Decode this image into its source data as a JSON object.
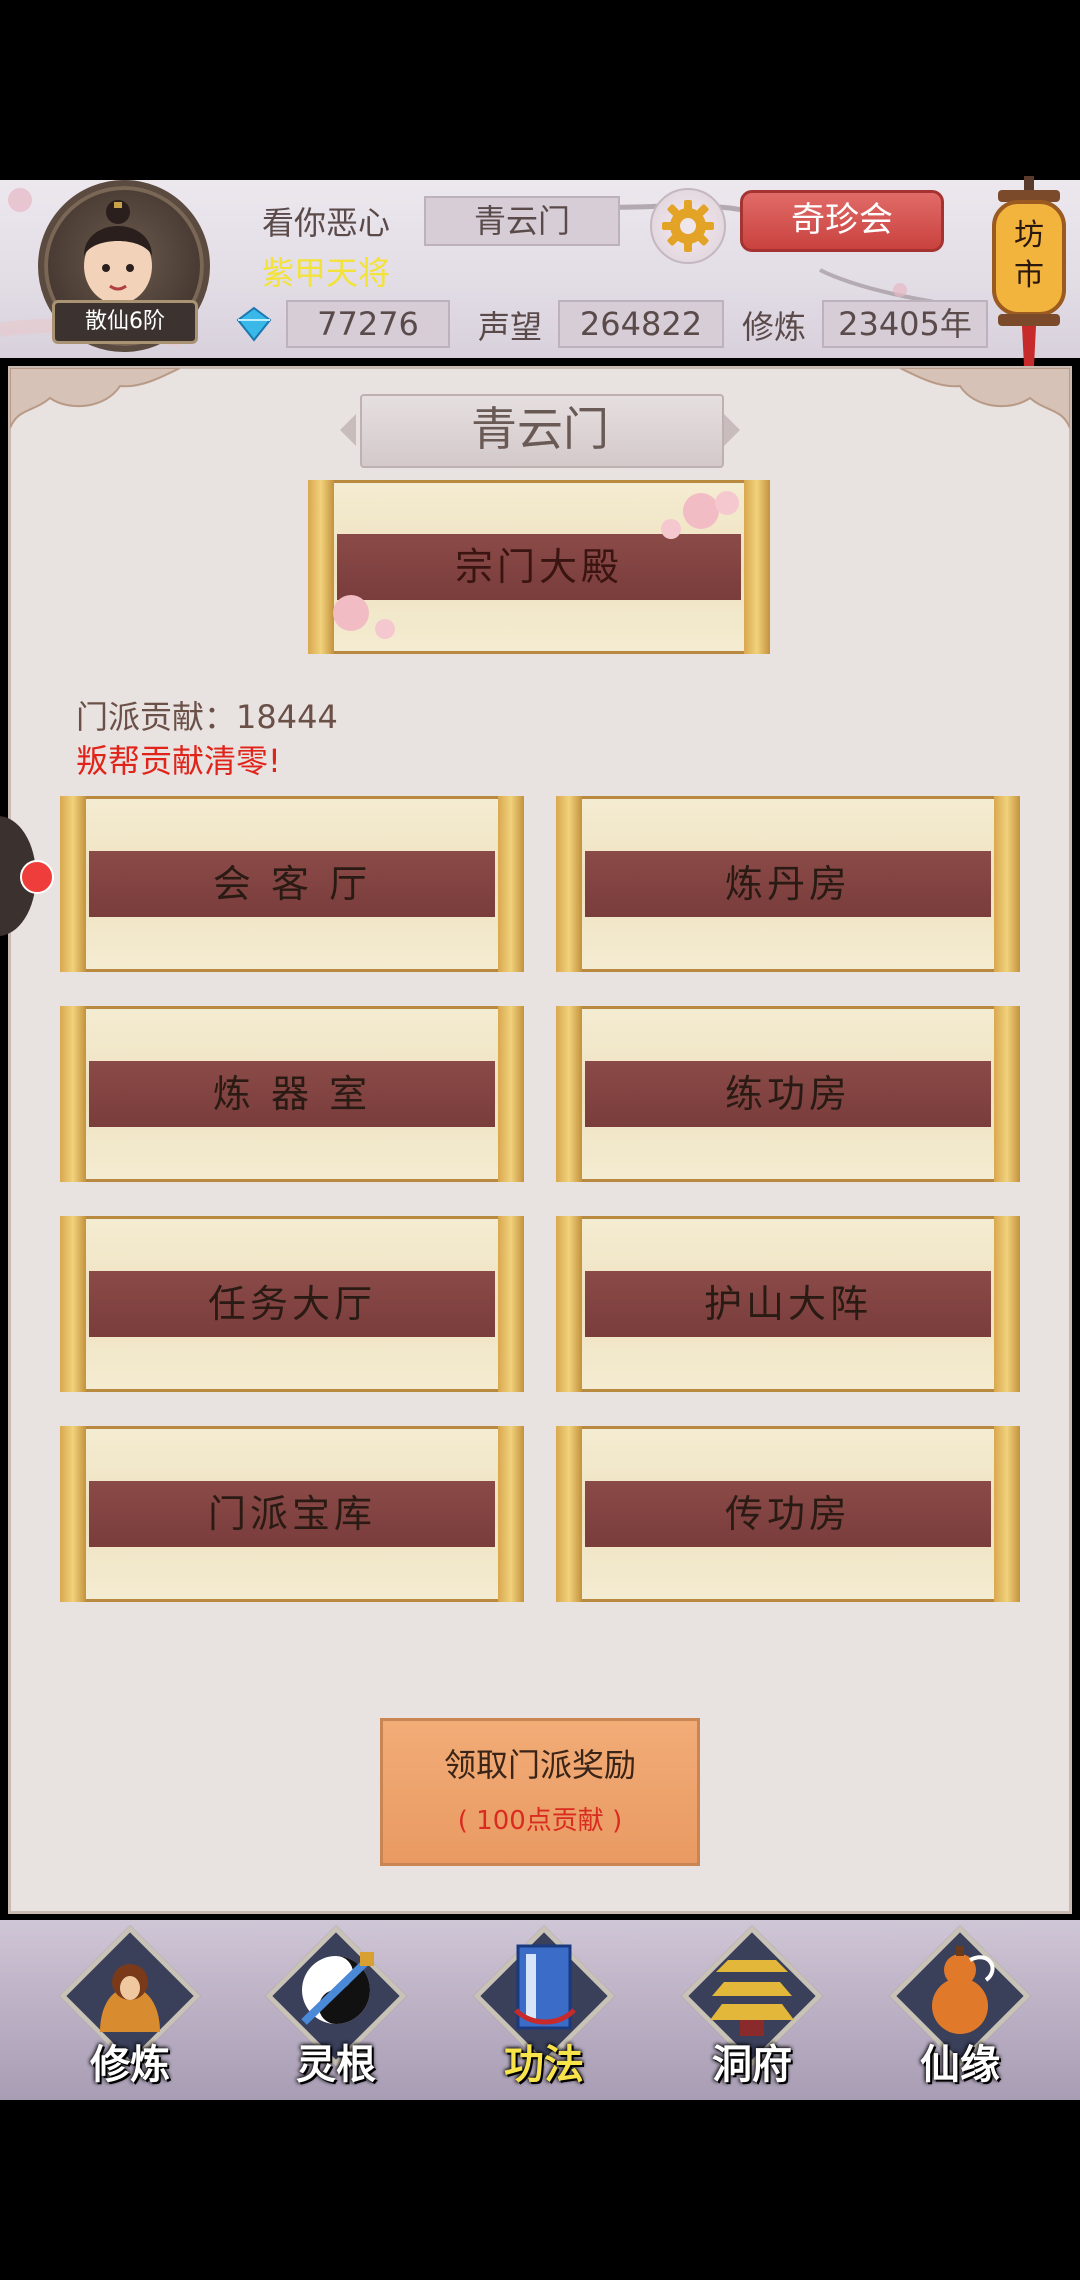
{
  "header": {
    "rank": "散仙6阶",
    "player_name": "看你恶心",
    "title": "紫甲天将",
    "sect_name": "青云门",
    "treasure_button": "奇珍会",
    "lantern_text": [
      "坊",
      "市"
    ],
    "gems": "77276",
    "reputation_label": "声望",
    "reputation": "264822",
    "cultivation_label": "修炼",
    "cultivation": "23405年"
  },
  "main": {
    "sect_title": "青云门",
    "hall_button": "宗门大殿",
    "contribution": "门派贡献：18444",
    "warning": "叛帮贡献清零!",
    "buildings": [
      "会 客 厅",
      "炼丹房",
      "炼 器 室",
      "练功房",
      "任务大厅",
      "护山大阵",
      "门派宝库",
      "传功房"
    ],
    "reward_button": {
      "line1": "领取门派奖励",
      "line2": "( 100点贡献 )"
    }
  },
  "bottom_nav": [
    {
      "label": "修炼",
      "icon": "monk-icon",
      "color": "#d98b2f"
    },
    {
      "label": "灵根",
      "icon": "yin-yang-sword-icon",
      "color": "#4a88d8"
    },
    {
      "label": "功法",
      "icon": "book-icon",
      "color": "#3a6cc8"
    },
    {
      "label": "洞府",
      "icon": "pagoda-icon",
      "color": "#e3b83a"
    },
    {
      "label": "仙缘",
      "icon": "gourd-icon",
      "color": "#e07a2a"
    }
  ]
}
